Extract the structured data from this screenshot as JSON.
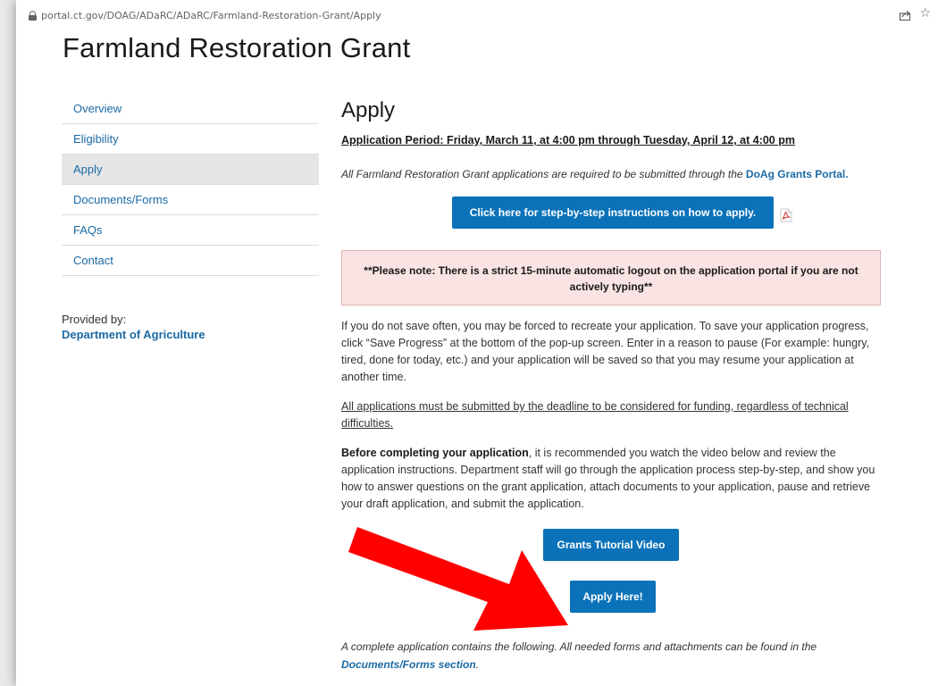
{
  "browser": {
    "url": "portal.ct.gov/DOAG/ADaRC/ADaRC/Farmland-Restoration-Grant/Apply"
  },
  "site": {
    "title": "Farmland Restoration Grant"
  },
  "sidebar": {
    "items": [
      {
        "label": "Overview"
      },
      {
        "label": "Eligibility"
      },
      {
        "label": "Apply",
        "active": true
      },
      {
        "label": "Documents/Forms"
      },
      {
        "label": "FAQs"
      },
      {
        "label": "Contact"
      }
    ],
    "provided_label": "Provided by:",
    "provider": "Department of Agriculture"
  },
  "main": {
    "heading": "Apply",
    "application_period": "Application Period: Friday, March 11, at 4:00 pm through Tuesday, April 12, at 4:00 pm",
    "intro_text": "All Farmland Restoration Grant applications are required to be submitted through the ",
    "intro_link": "DoAg Grants Portal.",
    "instructions_button": "Click here for step-by-step instructions on how to apply.",
    "notice": "**Please note: There is a strict 15-minute automatic logout on the application portal if you are not actively typing**",
    "paragraph_save": "If you do not save often, you may be forced to recreate your application. To save your application progress, click “Save Progress” at the bottom of the pop-up screen. Enter in a reason to pause (For example: hungry, tired, done for today, etc.) and your application will be saved so that you may resume your application at another time.",
    "paragraph_deadline": "All applications must be submitted by the deadline to be considered for funding, regardless of technical difficulties.",
    "paragraph_before_lead": "Before completing your application",
    "paragraph_before_rest": ", it is recommended you watch the video below and review the application instructions. Department staff will go through the application process step-by-step, and show you how to answer questions on the grant application, attach documents to your application, pause and retrieve your draft application, and submit the application.",
    "video_button": "Grants Tutorial Video",
    "apply_button": "Apply Here!",
    "closing_text": "A complete application contains the following. All needed forms and attachments can be found in the ",
    "closing_link": "Documents/Forms section",
    "closing_end": "."
  },
  "colors": {
    "link": "#1b6aa5",
    "button": "#0b72b9",
    "notice_bg": "#f9e3e3",
    "annotation_arrow": "#ff0000"
  },
  "icons": {
    "lock": "lock-icon",
    "share": "share-icon",
    "star": "star-icon",
    "pdf": "pdf-icon",
    "annotation": "red-arrow-icon"
  }
}
